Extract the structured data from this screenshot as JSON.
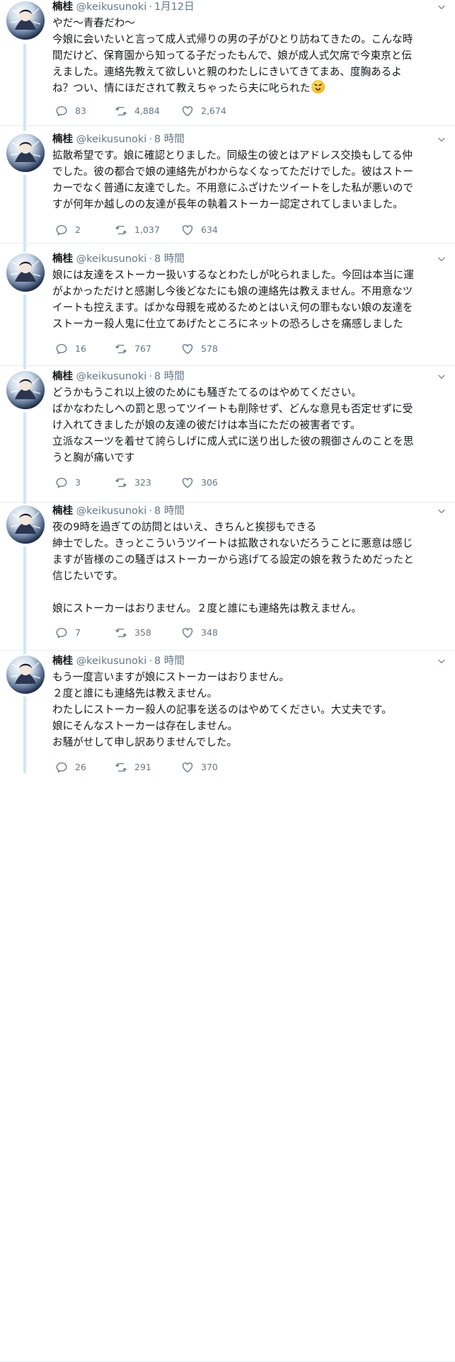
{
  "tweets": [
    {
      "name": "楠桂",
      "handle": "@keikusunoki",
      "time": "1月12日",
      "lines": [
        "やだ〜青春だわ〜",
        "今娘に会いたいと言って成人式帰りの男の子がひとり訪ねてきたの。こんな時",
        "間だけど、保育園から知ってる子だったもんで、娘が成人式欠席で今東京と伝",
        "えました。連絡先教えて欲しいと親のわたしにきいてきてまあ、度胸あるよ",
        "ね？つい、情にほだされて教えちゃったら夫に叱られた"
      ],
      "emoji": "persevering-face-emoji",
      "replies": "83",
      "retweets": "4,884",
      "likes": "2,674"
    },
    {
      "name": "楠桂",
      "handle": "@keikusunoki",
      "time": "8 時間",
      "lines": [
        "拡散希望です。娘に確認とりました。同級生の彼とはアドレス交換もしてる仲",
        "でした。彼の都合で娘の連絡先がわからなくなってただけでした。彼はストー",
        "カーでなく普通に友達でした。不用意にふざけたツイートをした私が悪いので",
        "すが何年か越しのの友達が長年の執着ストーカー認定されてしまいました。"
      ],
      "replies": "2",
      "retweets": "1,037",
      "likes": "634"
    },
    {
      "name": "楠桂",
      "handle": "@keikusunoki",
      "time": "8 時間",
      "lines": [
        "娘には友達をストーカー扱いするなとわたしが叱られました。今回は本当に運",
        "がよかっただけと感謝し今後どなたにも娘の連絡先は教えません。不用意なツ",
        "イートも控えます。ばかな母親を戒めるためとはいえ何の罪もない娘の友達を",
        "ストーカー殺人鬼に仕立てあげたところにネットの恐ろしさを痛感しました"
      ],
      "replies": "16",
      "retweets": "767",
      "likes": "578"
    },
    {
      "name": "楠桂",
      "handle": "@keikusunoki",
      "time": "8 時間",
      "lines": [
        "どうかもうこれ以上彼のためにも騒ぎたてるのはやめてください。",
        "ばかなわたしへの罰と思ってツイートも削除せず、どんな意見も否定せずに受",
        "け入れてきましたが娘の友達の彼だけは本当にただの被害者です。",
        "立派なスーツを着せて誇らしげに成人式に送り出した彼の親御さんのことを思",
        "うと胸が痛いです"
      ],
      "replies": "3",
      "retweets": "323",
      "likes": "306"
    },
    {
      "name": "楠桂",
      "handle": "@keikusunoki",
      "time": "8 時間",
      "lines": [
        "夜の9時を過ぎての訪問とはいえ、きちんと挨拶もできる",
        "紳士でした。きっとこういうツイートは拡散されないだろうことに悪意は感じ",
        "ますが皆様のこの騒ぎはストーカーから逃げてる設定の娘を救うためだったと",
        "信じたいです。",
        "",
        "娘にストーカーはおりません。２度と誰にも連絡先は教えません。"
      ],
      "replies": "7",
      "retweets": "358",
      "likes": "348"
    },
    {
      "name": "楠桂",
      "handle": "@keikusunoki",
      "time": "8 時間",
      "lines": [
        "もう一度言いますが娘にストーカーはおりません。",
        "２度と誰にも連絡先は教えません。",
        "わたしにストーカー殺人の記事を送るのはやめてください。大丈夫です。",
        "娘にそんなストーカーは存在しません。",
        "お騒がせして申し訳ありませんでした。"
      ],
      "replies": "26",
      "retweets": "291",
      "likes": "370"
    }
  ],
  "icons": {
    "reply": "reply-icon",
    "retweet": "retweet-icon",
    "like": "heart-icon",
    "menu": "chevron-down-icon"
  },
  "colors": {
    "text": "#14171a",
    "secondary": "#657786",
    "thread_line": "#cfe7f8",
    "divider": "#e6ecf0"
  }
}
